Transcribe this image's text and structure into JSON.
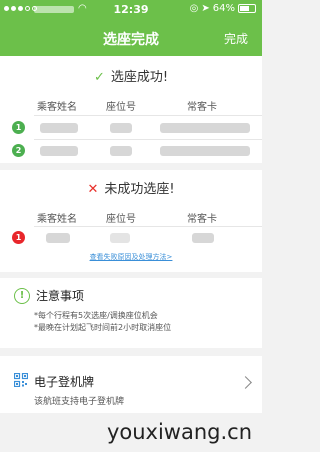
{
  "status_bar": {
    "time": "12:39",
    "battery": "64%",
    "wifi_icon": "wifi-icon",
    "location_icon": "location-arrow-icon"
  },
  "nav": {
    "title": "选座完成",
    "done": "完成"
  },
  "success": {
    "title": "选座成功!",
    "mark_icon": "check-icon",
    "headers": {
      "name": "乘客姓名",
      "seat": "座位号",
      "ffp": "常客卡"
    },
    "rows": [
      {
        "index": "1"
      },
      {
        "index": "2"
      }
    ]
  },
  "failure": {
    "title": "未成功选座!",
    "mark_icon": "cross-icon",
    "headers": {
      "name": "乘客姓名",
      "seat": "座位号",
      "ffp": "常客卡"
    },
    "rows": [
      {
        "index": "1"
      }
    ],
    "link": "查看失败原因及处理方法>"
  },
  "notice": {
    "title": "注意事项",
    "lines": [
      "*每个行程有5次选座/调换座位机会",
      "*最晚在计划起飞时间前2小时取消座位"
    ]
  },
  "boarding": {
    "title": "电子登机牌",
    "subtitle": "该航班支持电子登机牌"
  },
  "watermark": "youxiwang.cn",
  "colors": {
    "primary_green": "#6cc04a",
    "error_red": "#e8302a",
    "link_blue": "#3a8fd8"
  }
}
